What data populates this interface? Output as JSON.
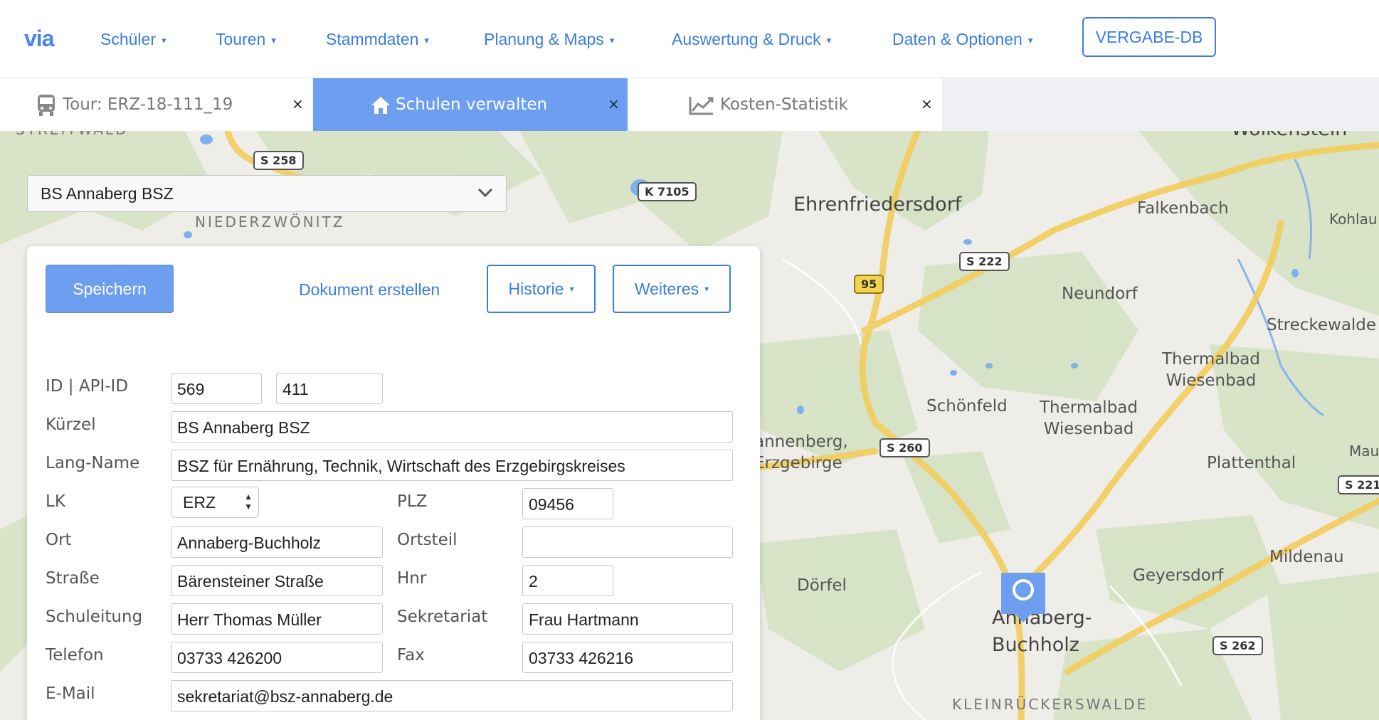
{
  "app": {
    "logo": "via",
    "vergabe_label": "VERGABE-DB"
  },
  "nav": {
    "items": [
      {
        "label": "Schüler"
      },
      {
        "label": "Touren"
      },
      {
        "label": "Stammdaten"
      },
      {
        "label": "Planung & Maps"
      },
      {
        "label": "Auswertung & Druck"
      },
      {
        "label": "Daten & Optionen"
      }
    ],
    "caret": "▾"
  },
  "tabs": [
    {
      "label": "Tour: ERZ-18-111_19",
      "icon": "bus-icon",
      "active": false
    },
    {
      "label": "Schulen verwalten",
      "icon": "home-icon",
      "active": true
    },
    {
      "label": "Kosten-Statistik",
      "icon": "chart-line-icon",
      "active": false
    }
  ],
  "tab_close": "×",
  "school_select": {
    "value": "BS Annaberg BSZ",
    "chevron": "⌄"
  },
  "toolbar": {
    "save_label": "Speichern",
    "document_label": "Dokument erstellen",
    "history_label": "Historie",
    "more_label": "Weiteres",
    "caret": "▾"
  },
  "form": {
    "id_label": "ID | API-ID",
    "id": "569",
    "api_id": "411",
    "kuerzel_label": "Kürzel",
    "kuerzel": "BS Annaberg BSZ",
    "langname_label": "Lang-Name",
    "langname": "BSZ für Ernährung, Technik, Wirtschaft des Erzgebirgskreises",
    "lk_label": "LK",
    "lk": "ERZ",
    "plz_label": "PLZ",
    "plz": "09456",
    "ort_label": "Ort",
    "ort": "Annaberg-Buchholz",
    "ortsteil_label": "Ortsteil",
    "ortsteil": "",
    "strasse_label": "Straße",
    "strasse": "Bärensteiner Straße",
    "hnr_label": "Hnr",
    "hnr": "2",
    "schulleitung_label": "Schuleitung",
    "schulleitung": "Herr Thomas Müller",
    "sekretariat_label": "Sekretariat",
    "sekretariat": "Frau Hartmann",
    "telefon_label": "Telefon",
    "telefon": "03733 426200",
    "fax_label": "Fax",
    "fax": "03733 426216",
    "email_label": "E-Mail",
    "email": "sekretariat@bsz-annaberg.de"
  },
  "map": {
    "places": [
      {
        "name": "Ehrenfriedersdorf"
      },
      {
        "name": "Falkenbach"
      },
      {
        "name": "Kohlau"
      },
      {
        "name": "Neundorf"
      },
      {
        "name": "Streckewalde"
      },
      {
        "name": "Thermalbad Wiesenbad"
      },
      {
        "name": "Schönfeld"
      },
      {
        "name": "Thermalbad Wiesenbad"
      },
      {
        "name": "Plattenthal"
      },
      {
        "name": "Mildenau"
      },
      {
        "name": "Geyersdorf"
      },
      {
        "name": "Dörfel"
      },
      {
        "name": "Annaberg-Buchholz"
      },
      {
        "name": "KLEINRÜCKERSWALDE"
      },
      {
        "name": "NIEDERZWÖNITZ"
      },
      {
        "name": "Wolkenstein"
      },
      {
        "name": "annenberg, Erzgebirge"
      },
      {
        "name": "STREITWALD"
      },
      {
        "name": "Maue"
      }
    ],
    "roads": [
      "S 258",
      "K 7105",
      "S 222",
      "95",
      "S 260",
      "S 221",
      "S 262"
    ]
  }
}
